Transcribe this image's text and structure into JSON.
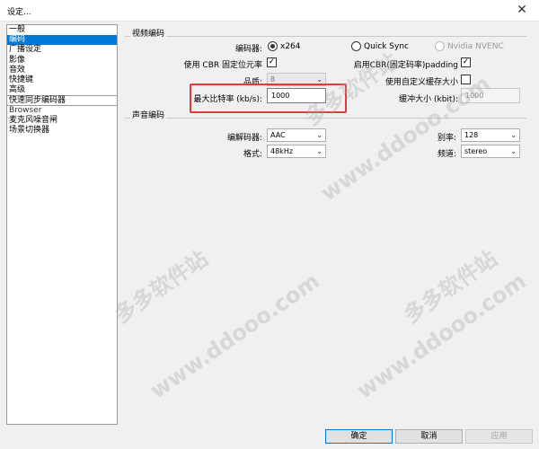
{
  "window": {
    "title": "设定...",
    "close_glyph": "✕"
  },
  "sidebar": {
    "items": [
      "一般",
      "编码",
      "广播设定",
      "影像",
      "音效",
      "快捷键",
      "高级",
      "快速同步编码器"
    ],
    "sub_items": [
      "Browser",
      "麦克风噪音闸",
      "场景切换器"
    ],
    "selected": "编码"
  },
  "video": {
    "section_title": "视频编码",
    "encoder_label": "编码器:",
    "encoder_options": [
      "x264",
      "Quick Sync",
      "Nvidia NVENC"
    ],
    "encoder_selected": "x264",
    "cbr_label": "使用 CBR 固定位元率",
    "cbr_checked": "✓",
    "cbr_padding_label": "启用CBR(固定码率)padding",
    "cbr_padding_checked": "✓",
    "quality_label": "品质:",
    "quality_value": "8",
    "custom_buffer_label": "使用自定义缓存大小",
    "max_bitrate_label": "最大比特率 (kb/s):",
    "max_bitrate_value": "1000",
    "buffer_size_label": "缓冲大小 (kbit):",
    "buffer_size_value": "1000"
  },
  "audio": {
    "section_title": "声音编码",
    "codec_label": "编解码器:",
    "codec_value": "AAC",
    "bitrate_label": "别率:",
    "bitrate_value": "128",
    "format_label": "格式:",
    "format_value": "48kHz",
    "channel_label": "频道:",
    "channel_value": "stereo"
  },
  "buttons": {
    "ok": "确定",
    "cancel": "取消",
    "apply": "应用"
  },
  "watermark": {
    "text_cn": "多多软件站",
    "text_url": "www.ddooo.com"
  },
  "colors": {
    "selection": "#0078d7",
    "highlight": "#e03a3a"
  }
}
